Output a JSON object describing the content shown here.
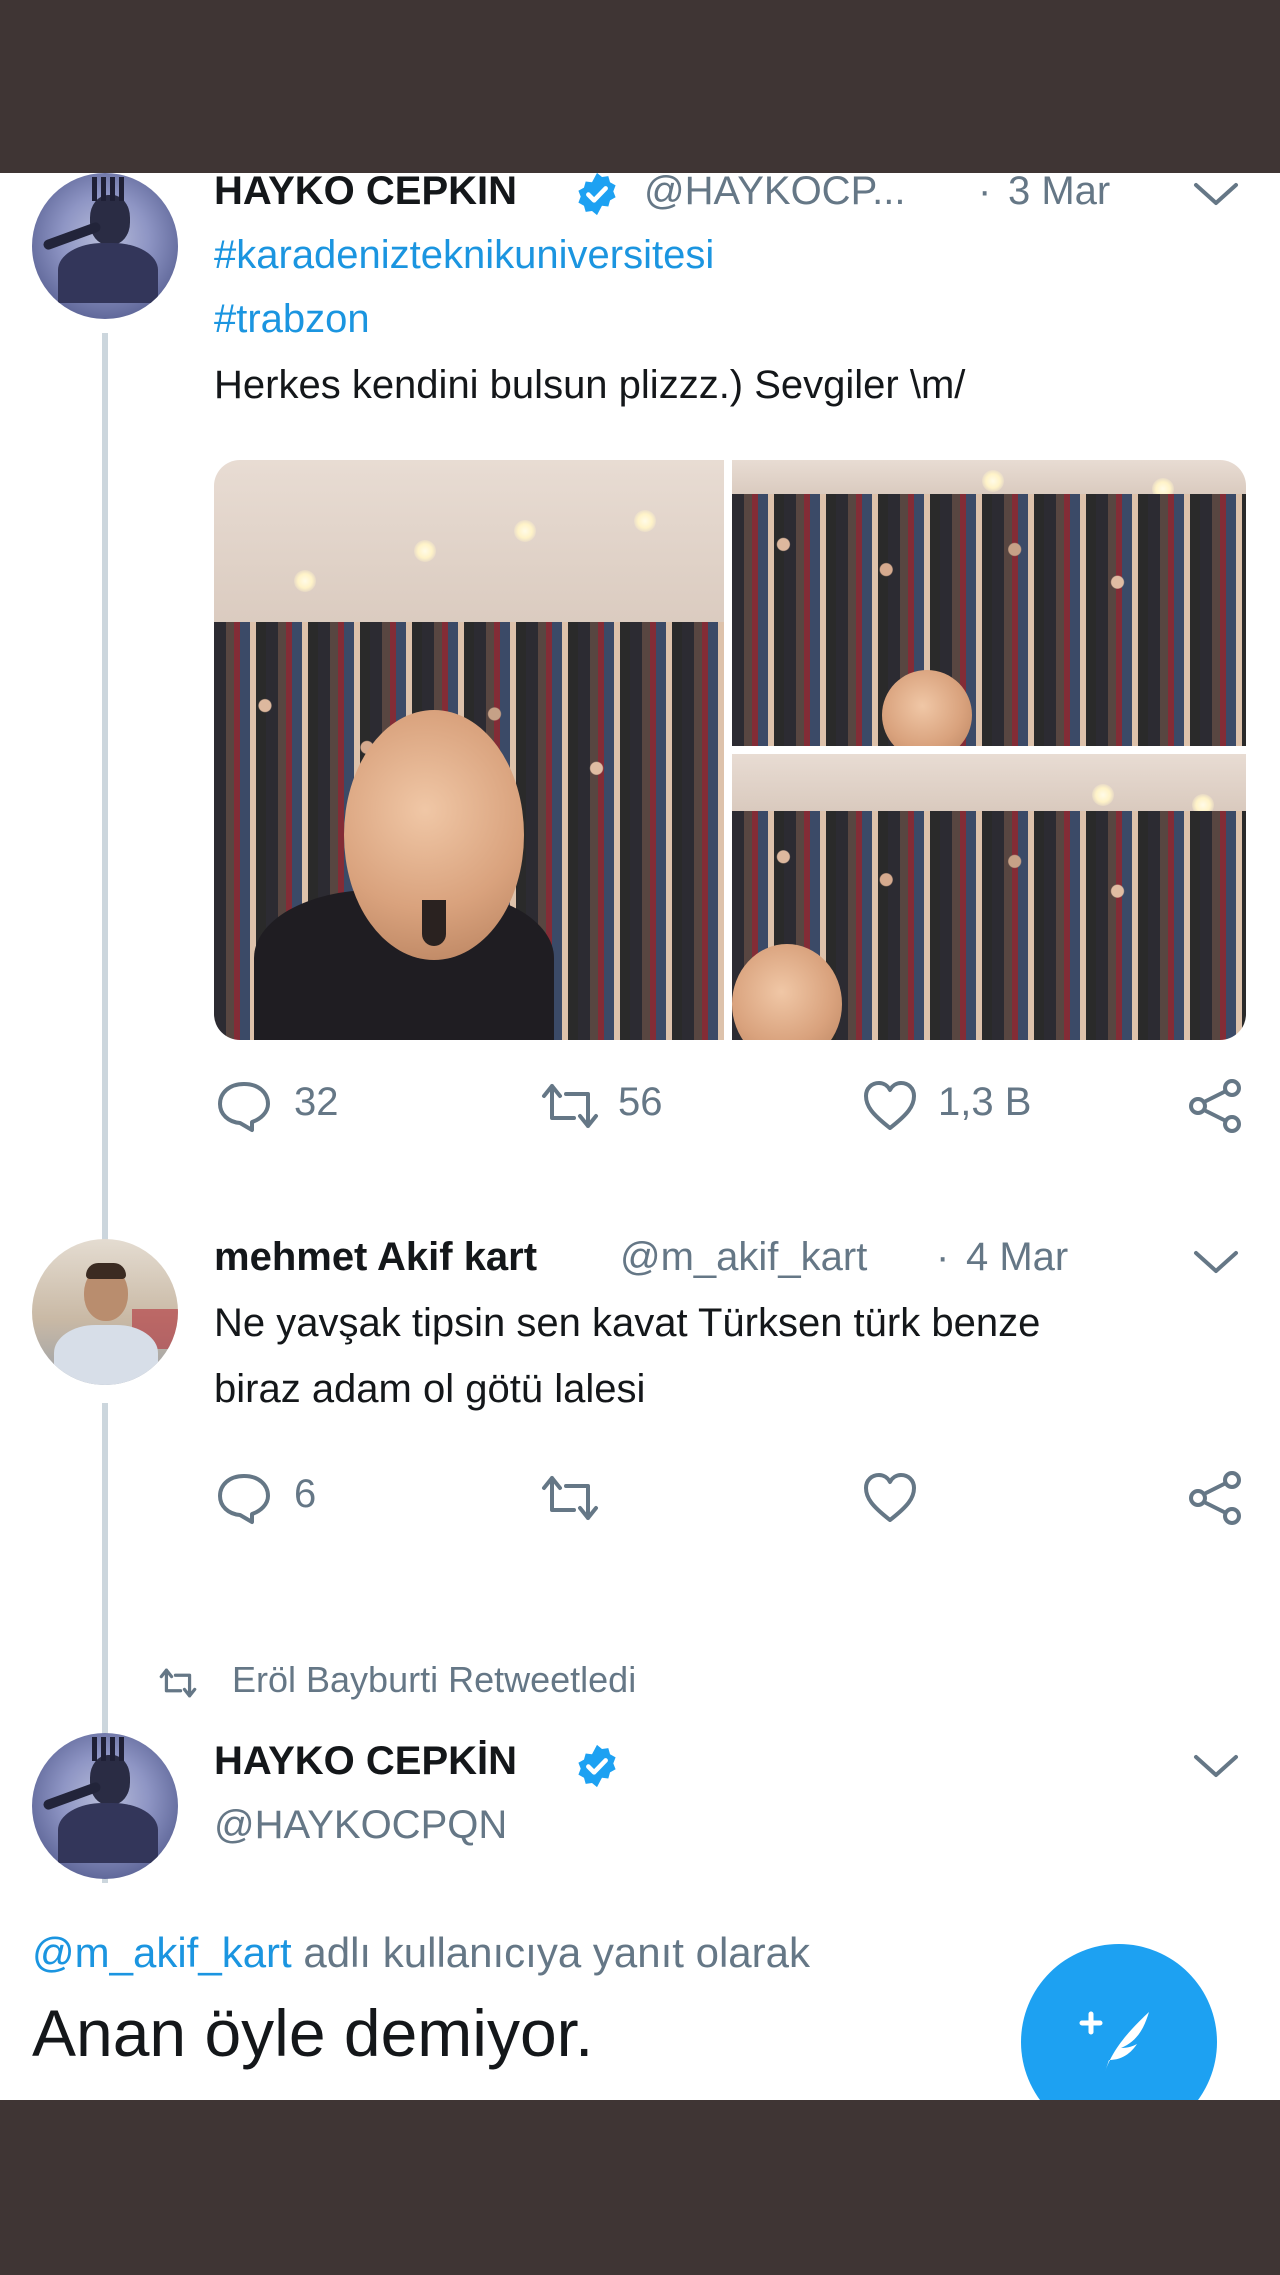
{
  "tweet1": {
    "name": "HAYKO CEPKIN",
    "handle": "@HAYKOCP...",
    "date": "3 Mar",
    "hashtag1": "#karadenizteknikuniversitesi",
    "hashtag2": "#trabzon",
    "text": "Herkes kendini bulsun plizzz.) Sevgiler \\m/",
    "stats": {
      "replies": "32",
      "retweets": "56",
      "likes": "1,3 B"
    }
  },
  "tweet2": {
    "name": "mehmet Akif kart",
    "handle": "@m_akif_kart",
    "date": "4 Mar",
    "line1": "Ne yavşak tipsin sen  kavat Türksen türk benze",
    "line2": "biraz adam ol götü lalesi",
    "stats": {
      "replies": "6"
    }
  },
  "retweet_notice": "Eröl Bayburti Retweetledi",
  "tweet3": {
    "name": "HAYKO CEPKİN",
    "handle": "@HAYKOCPQN",
    "reply_mention": "@m_akif_kart",
    "reply_suffix": " adlı kullanıcıya yanıt olarak",
    "text": "Anan öyle demiyor."
  },
  "colors": {
    "accent": "#1da1f2",
    "link": "#1b95e0",
    "muted": "#657786"
  },
  "icons": [
    "reply-icon",
    "retweet-icon",
    "like-icon",
    "share-icon",
    "verified-icon",
    "chevron-down-icon",
    "compose-icon"
  ]
}
